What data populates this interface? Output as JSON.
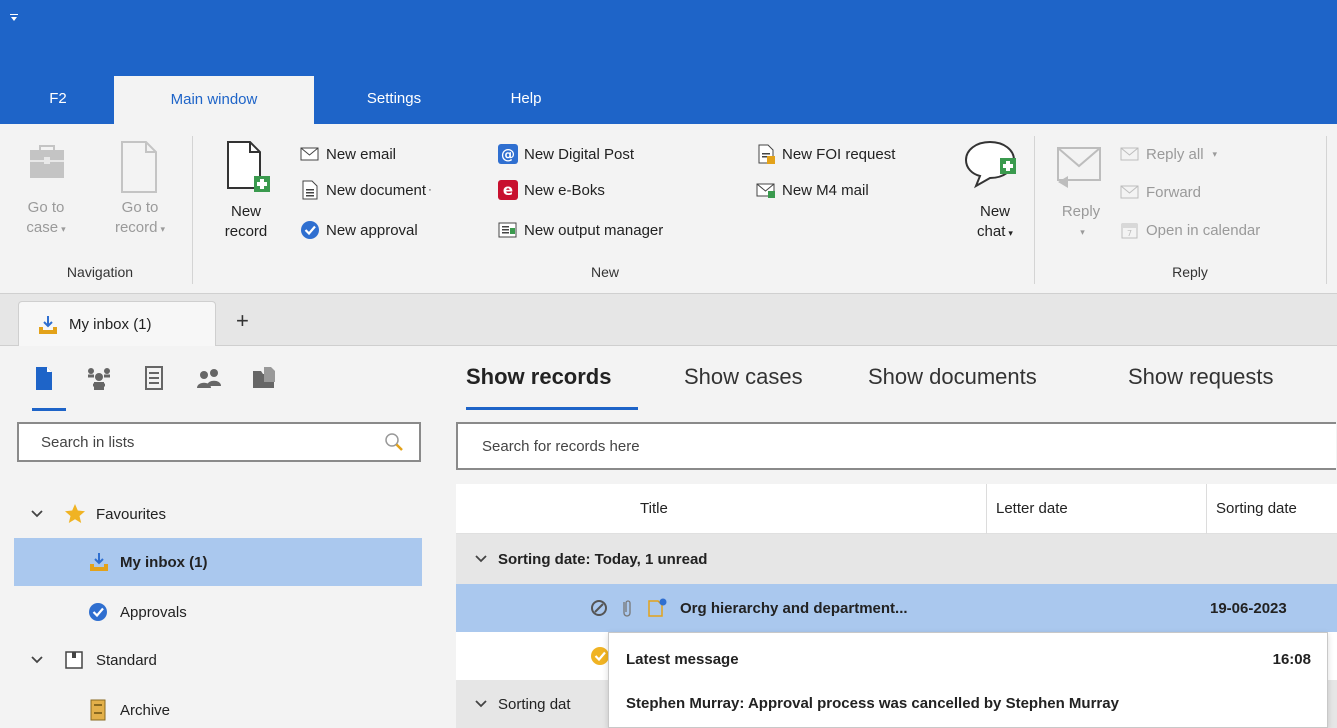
{
  "ribbon_tabs": [
    "F2",
    "Main window",
    "Settings",
    "Help"
  ],
  "ribbon": {
    "navigation": {
      "go_to_case": [
        "Go to",
        "case"
      ],
      "go_to_record": [
        "Go to",
        "record"
      ],
      "label": "Navigation"
    },
    "new": {
      "new_record": [
        "New",
        "record"
      ],
      "new_email": "New email",
      "new_document": "New document",
      "new_approval": "New approval",
      "new_digital_post": "New Digital Post",
      "new_eboks": "New e-Boks",
      "new_output_manager": "New output manager",
      "new_foi_request": "New FOI request",
      "new_m4_mail": "New M4 mail",
      "new_chat": [
        "New",
        "chat"
      ],
      "label": "New"
    },
    "reply": {
      "reply": "Reply",
      "reply_all": "Reply all",
      "forward": "Forward",
      "open_in_calendar": "Open in calendar",
      "label": "Reply"
    }
  },
  "doc_tab": {
    "label": "My inbox (1)"
  },
  "left": {
    "search_placeholder": "Search in lists",
    "tree": {
      "favourites": "Favourites",
      "my_inbox": "My inbox (1)",
      "approvals": "Approvals",
      "standard": "Standard",
      "archive": "Archive"
    }
  },
  "right": {
    "view_tabs": [
      "Show records",
      "Show cases",
      "Show documents",
      "Show requests"
    ],
    "search_placeholder": "Search for records here",
    "columns": [
      "Title",
      "Letter date",
      "Sorting date"
    ],
    "group_today": "Sorting date:  Today, 1 unread",
    "group_other": "Sorting dat",
    "row1": {
      "title": "Org hierarchy and department...",
      "sorting_date": "19-06-2023"
    },
    "tooltip": {
      "heading": "Latest message",
      "time": "16:08",
      "text": "Stephen Murray: Approval process was cancelled by Stephen Murray"
    }
  },
  "colors": {
    "brand": "#1e64c8",
    "selection": "#aac8ee"
  }
}
